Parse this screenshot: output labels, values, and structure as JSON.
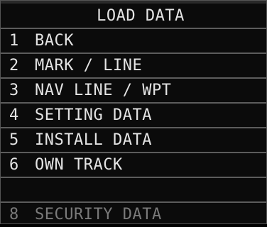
{
  "menu": {
    "title": "LOAD DATA",
    "items": [
      {
        "number": "1",
        "label": "BACK",
        "enabled": true
      },
      {
        "number": "2",
        "label": "MARK / LINE",
        "enabled": true
      },
      {
        "number": "3",
        "label": "NAV LINE / WPT",
        "enabled": true
      },
      {
        "number": "4",
        "label": "SETTING DATA",
        "enabled": true
      },
      {
        "number": "5",
        "label": "INSTALL DATA",
        "enabled": true
      },
      {
        "number": "6",
        "label": "OWN TRACK",
        "enabled": true
      },
      {
        "number": "",
        "label": "",
        "enabled": false
      },
      {
        "number": "8",
        "label": "SECURITY DATA",
        "enabled": false
      }
    ]
  },
  "colors": {
    "background": "#0b0b0b",
    "text": "#e4e4e4",
    "disabled_text": "#7a7a7a",
    "separator": "#5c5c5c"
  }
}
